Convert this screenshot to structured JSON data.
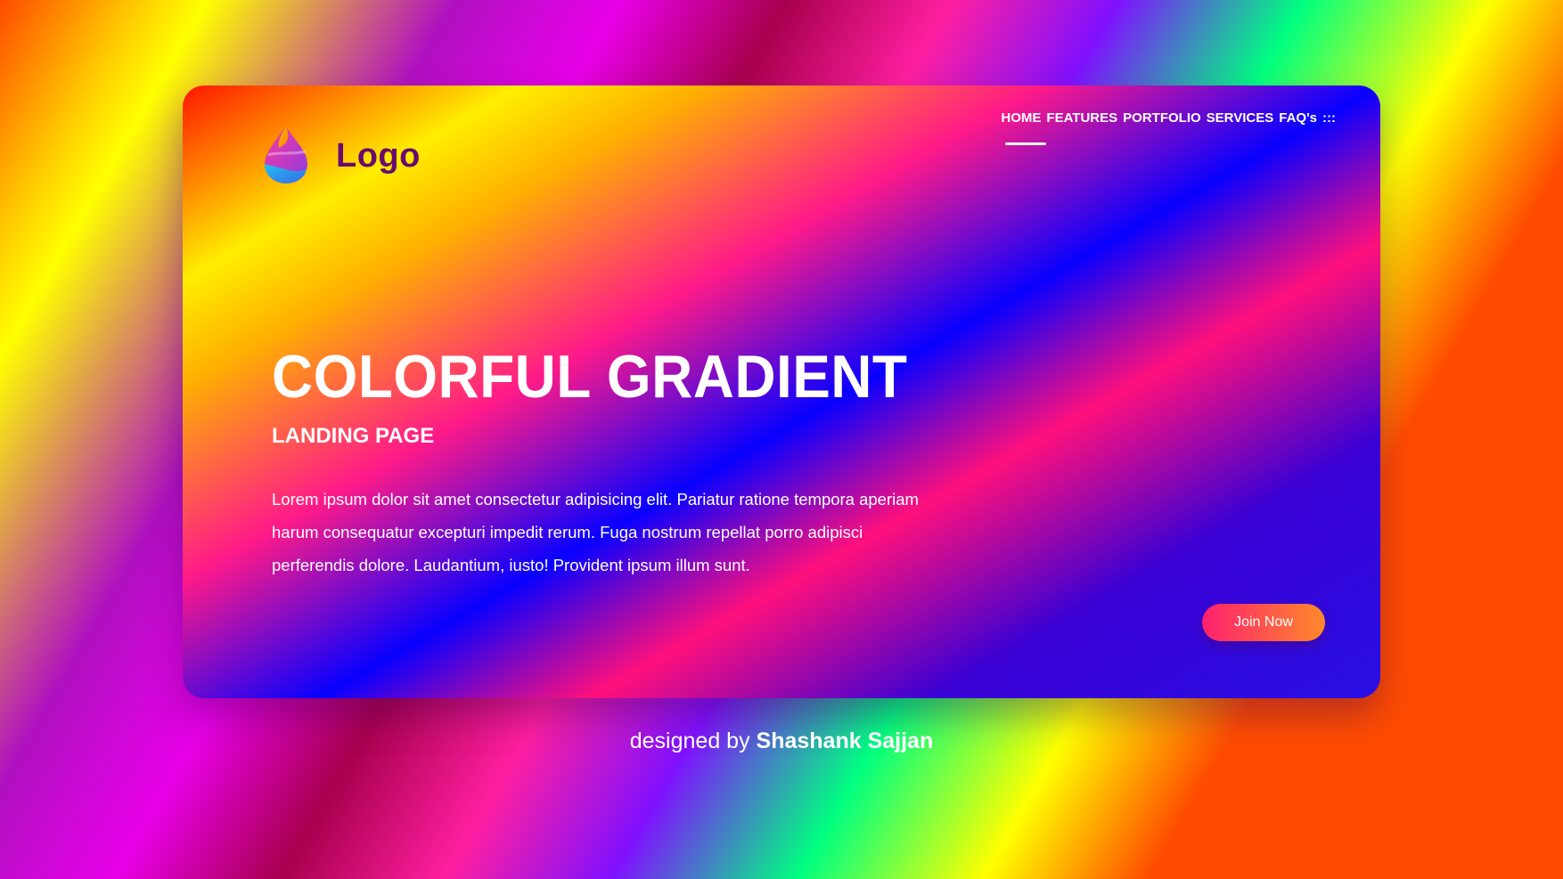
{
  "logo": {
    "text": "Logo",
    "icon": "flame-drop-icon"
  },
  "nav": {
    "items": [
      "HOME",
      "FEATURES",
      "PORTFOLIO",
      "SERVICES",
      "FAQ's",
      ":::"
    ],
    "active_index": 0
  },
  "hero": {
    "title": "COLORFUL GRADIENT",
    "subtitle": "LANDING PAGE",
    "description": "Lorem ipsum dolor sit amet consectetur adipisicing elit. Pariatur ratione tempora aperiam harum consequatur excepturi impedit rerum. Fuga nostrum repellat porro adipisci perferendis dolore. Laudantium, iusto! Provident ipsum illum sunt.",
    "cta_label": "Join Now"
  },
  "credit": {
    "prefix": "designed by",
    "name": "Shashank Sajjan"
  },
  "colors": {
    "logo_text": "#6a0a6e",
    "cta_start": "#ff1f6e",
    "cta_end": "#ff8a2a",
    "text": "#ffffff"
  }
}
